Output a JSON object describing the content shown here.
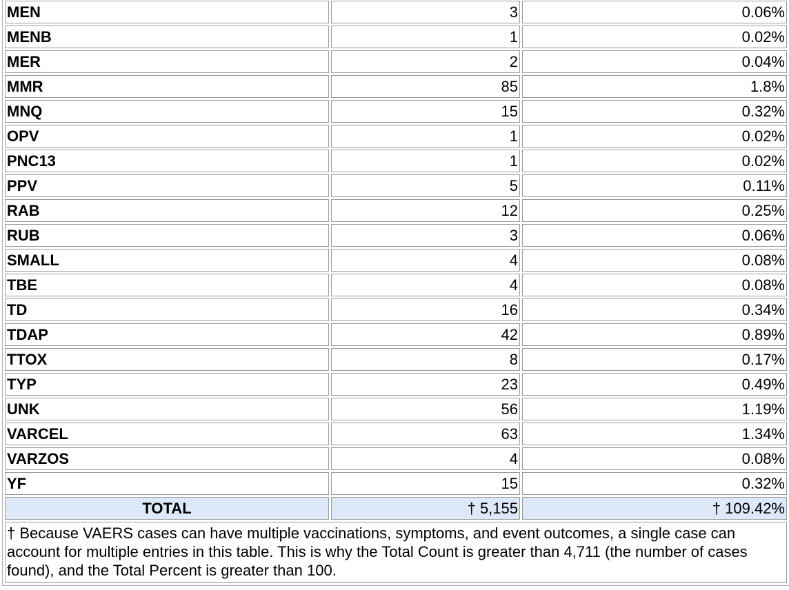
{
  "rows": [
    {
      "vaccine": "MEN",
      "count": "3",
      "percent": "0.06%"
    },
    {
      "vaccine": "MENB",
      "count": "1",
      "percent": "0.02%"
    },
    {
      "vaccine": "MER",
      "count": "2",
      "percent": "0.04%"
    },
    {
      "vaccine": "MMR",
      "count": "85",
      "percent": "1.8%"
    },
    {
      "vaccine": "MNQ",
      "count": "15",
      "percent": "0.32%"
    },
    {
      "vaccine": "OPV",
      "count": "1",
      "percent": "0.02%"
    },
    {
      "vaccine": "PNC13",
      "count": "1",
      "percent": "0.02%"
    },
    {
      "vaccine": "PPV",
      "count": "5",
      "percent": "0.11%"
    },
    {
      "vaccine": "RAB",
      "count": "12",
      "percent": "0.25%"
    },
    {
      "vaccine": "RUB",
      "count": "3",
      "percent": "0.06%"
    },
    {
      "vaccine": "SMALL",
      "count": "4",
      "percent": "0.08%"
    },
    {
      "vaccine": "TBE",
      "count": "4",
      "percent": "0.08%"
    },
    {
      "vaccine": "TD",
      "count": "16",
      "percent": "0.34%"
    },
    {
      "vaccine": "TDAP",
      "count": "42",
      "percent": "0.89%"
    },
    {
      "vaccine": "TTOX",
      "count": "8",
      "percent": "0.17%"
    },
    {
      "vaccine": "TYP",
      "count": "23",
      "percent": "0.49%"
    },
    {
      "vaccine": "UNK",
      "count": "56",
      "percent": "1.19%"
    },
    {
      "vaccine": "VARCEL",
      "count": "63",
      "percent": "1.34%"
    },
    {
      "vaccine": "VARZOS",
      "count": "4",
      "percent": "0.08%"
    },
    {
      "vaccine": "YF",
      "count": "15",
      "percent": "0.32%"
    }
  ],
  "total": {
    "label": "TOTAL",
    "count": "† 5,155",
    "percent": "† 109.42%"
  },
  "footnote": "† Because VAERS cases can have multiple vaccinations, symptoms, and event outcomes, a single case can account for multiple entries in this table. This is why the Total Count is greater than 4,711 (the number of cases found), and the Total Percent is greater than 100.",
  "colors": {
    "total_row_background": "#dde8f8",
    "cell_border": "#9a9a9a"
  }
}
